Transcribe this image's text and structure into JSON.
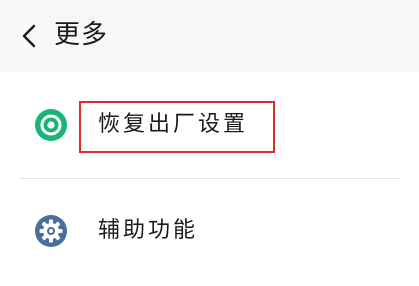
{
  "header": {
    "title": "更多",
    "back_icon": "chevron-left-icon"
  },
  "items": [
    {
      "label": "恢复出厂设置",
      "icon": "restore-icon",
      "icon_color": "#19b47a",
      "highlighted": true
    },
    {
      "label": "辅助功能",
      "icon": "accessibility-gear-icon",
      "icon_color": "#4a6f9c",
      "highlighted": false
    }
  ],
  "colors": {
    "highlight_border": "#d9302c",
    "background": "#f5f5f5",
    "list_background": "#ffffff"
  }
}
